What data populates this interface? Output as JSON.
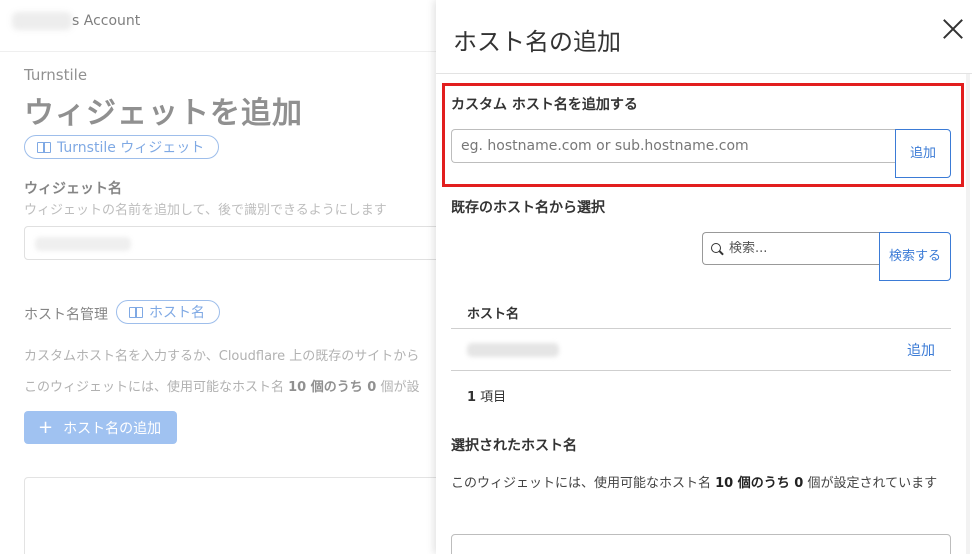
{
  "header": {
    "account_suffix": "s Account"
  },
  "background": {
    "breadcrumb": "Turnstile",
    "title": "ウィジェットを追加",
    "docs_pill": "Turnstile ウィジェット",
    "widget_name_label": "ウィジェット名",
    "widget_name_help": "ウィジェットの名前を追加して、後で識別できるようにします",
    "hostname_mgmt_label": "ホスト名管理",
    "hostname_pill": "ホスト名",
    "hostname_help": "カスタムホスト名を入力するか、Cloudflare 上の既存のサイトから",
    "usage_prefix": "このウィジェットには、使用可能なホスト名 ",
    "usage_bold": "10 個のうち 0",
    "usage_suffix": " 個が設",
    "add_hostname_button": "ホスト名の追加"
  },
  "panel": {
    "title": "ホスト名の追加",
    "custom_section_label": "カスタム ホスト名を追加する",
    "custom_input_placeholder": "eg. hostname.com or sub.hostname.com",
    "custom_add_button": "追加",
    "existing_section_label": "既存のホスト名から選択",
    "search_placeholder": "検索...",
    "search_button": "検索する",
    "table": {
      "header": "ホスト名",
      "rows": [
        {
          "action": "追加"
        }
      ]
    },
    "count_number": "1",
    "count_label": " 項目",
    "selected_section_label": "選択されたホスト名",
    "usage_prefix": "このウィジェットには、使用可能なホスト名 ",
    "usage_bold": "10 個のうち 0",
    "usage_suffix": " 個が設定されています"
  },
  "colors": {
    "accent": "#3b7bd6",
    "highlight": "#e21e1e",
    "button_bg": "#6ea2ea"
  }
}
